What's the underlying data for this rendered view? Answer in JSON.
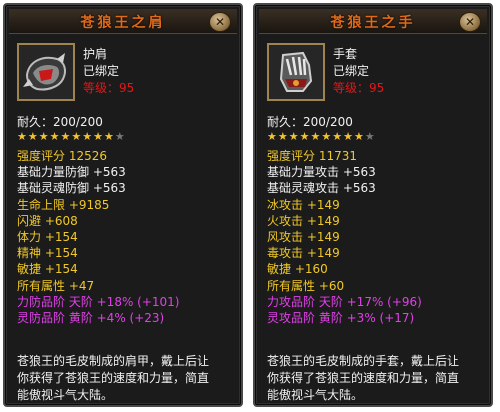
{
  "left": {
    "title": "苍狼王之肩",
    "close_label": "✕",
    "item_name": "护肩",
    "bound": "已绑定",
    "level_label": "等级：",
    "level_value": "95",
    "durability": "耐久：200/200",
    "stars_total": 10,
    "stars_filled": 9,
    "stats": [
      {
        "text": "强度评分 12526",
        "color": "gold"
      },
      {
        "text": "基础力量防御 +563",
        "color": "white"
      },
      {
        "text": "基础灵魂防御 +563",
        "color": "white"
      },
      {
        "text": "生命上限 +9185",
        "color": "gold"
      },
      {
        "text": "闪避 +608",
        "color": "gold"
      },
      {
        "text": "体力 +154",
        "color": "gold"
      },
      {
        "text": "精神 +154",
        "color": "gold"
      },
      {
        "text": "敏捷 +154",
        "color": "gold"
      },
      {
        "text": "所有属性 +47",
        "color": "gold"
      },
      {
        "text": "力防品阶  天阶 +18% (+101)",
        "color": "pink"
      },
      {
        "text": "灵防品阶  黄阶 +4% (+23)",
        "color": "pink"
      }
    ],
    "description": [
      "苍狼王的毛皮制成的肩甲，戴上后让",
      "你获得了苍狼王的速度和力量，简直",
      "能傲视斗气大陆。"
    ]
  },
  "right": {
    "title": "苍狼王之手",
    "close_label": "✕",
    "item_name": "手套",
    "bound": "已绑定",
    "level_label": "等级：",
    "level_value": "95",
    "durability": "耐久：200/200",
    "stars_total": 10,
    "stars_filled": 9,
    "stats": [
      {
        "text": "强度评分 11731",
        "color": "gold"
      },
      {
        "text": "基础力量攻击 +563",
        "color": "white"
      },
      {
        "text": "基础灵魂攻击 +563",
        "color": "white"
      },
      {
        "text": "冰攻击 +149",
        "color": "gold"
      },
      {
        "text": "火攻击 +149",
        "color": "gold"
      },
      {
        "text": "风攻击 +149",
        "color": "gold"
      },
      {
        "text": "毒攻击 +149",
        "color": "gold"
      },
      {
        "text": "敏捷 +160",
        "color": "gold"
      },
      {
        "text": "所有属性 +60",
        "color": "gold"
      },
      {
        "text": "力攻品阶  天阶 +17% (+96)",
        "color": "pink"
      },
      {
        "text": "灵攻品阶  黄阶 +3% (+17)",
        "color": "pink"
      }
    ],
    "description": [
      "苍狼王的毛皮制成的手套，戴上后让",
      "你获得了苍狼王的速度和力量，简直",
      "能傲视斗气大陆。"
    ]
  }
}
